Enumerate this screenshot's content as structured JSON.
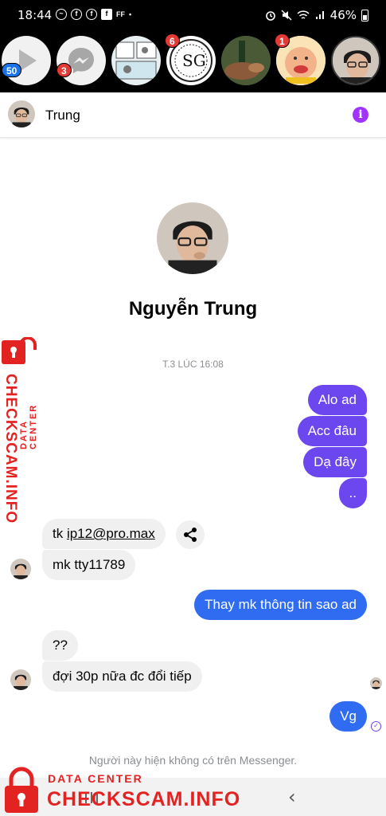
{
  "status_bar": {
    "time": "18:44",
    "battery": "46%",
    "left_icons": [
      "messenger-icon",
      "facebook-icon",
      "facebook-icon",
      "facebook-square-icon",
      "ff-icon",
      "dot-icon"
    ],
    "right_icons": [
      "alarm-icon",
      "mute-icon",
      "wifi-icon",
      "signal-icon",
      "battery-icon"
    ]
  },
  "chat_heads": [
    {
      "name": "play-store-head",
      "badge": "50"
    },
    {
      "name": "messenger-head",
      "badge": "3"
    },
    {
      "name": "chat-head-3",
      "badge": ""
    },
    {
      "name": "chat-head-4",
      "badge": "6"
    },
    {
      "name": "chat-head-5",
      "badge": ""
    },
    {
      "name": "chat-head-6",
      "badge": "1"
    },
    {
      "name": "chat-head-trung",
      "badge": ""
    }
  ],
  "header": {
    "title": "Trung"
  },
  "profile": {
    "name": "Nguyễn Trung"
  },
  "timestamp": "T.3 LÚC 16:08",
  "messages": {
    "m1": "Alo ad",
    "m2": "Acc đâu",
    "m3": "Dạ đây",
    "m4": "..",
    "in1_prefix": "tk ",
    "in1_link": "ip12@pro.max",
    "in2": "mk tty11789",
    "out5": "Thay mk thông tin sao ad",
    "in3": "??",
    "in4": "đợi 30p nữa đc đổi tiếp",
    "out6": "Vg"
  },
  "notice": "Người này hiện không có trên Messenger.",
  "watermark": {
    "top": "DATA CENTER",
    "bottom": "CHECKSCAM.INFO"
  },
  "colors": {
    "purple_bubble": "#6c46ee",
    "blue_bubble": "#2f6cf1",
    "info_icon": "#a033ff",
    "watermark": "#e32222"
  }
}
